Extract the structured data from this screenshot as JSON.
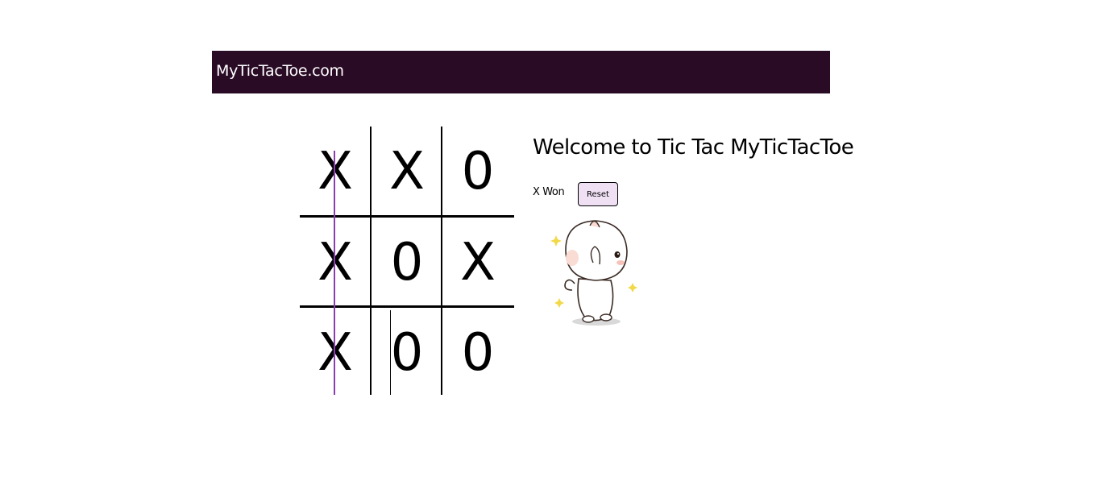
{
  "navbar": {
    "brand": "MyTicTacToe.com"
  },
  "board": {
    "cells": [
      "X",
      "X",
      "0",
      "X",
      "0",
      "X",
      "X",
      "0",
      "0"
    ]
  },
  "info": {
    "title": "Welcome to Tic Tac MyTicTacToe",
    "status": "X Won",
    "reset_label": "Reset"
  },
  "colors": {
    "navbar_bg": "#2a0b26",
    "win_line": "#8a3db0",
    "reset_bg": "#efe0f4"
  },
  "icons": {
    "celebration": "dancing-cat-gif"
  }
}
